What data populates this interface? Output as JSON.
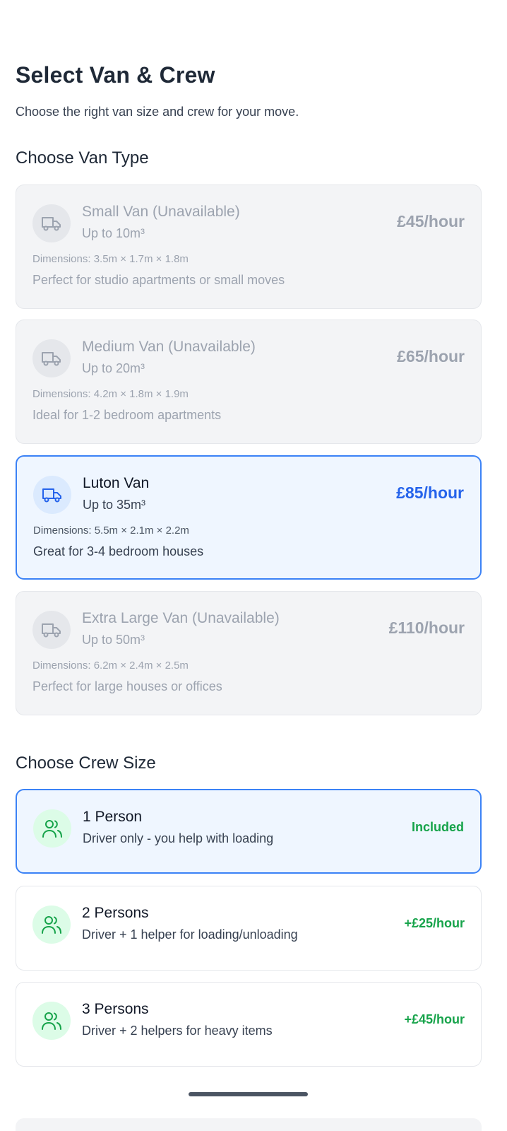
{
  "header": {
    "title": "Select Van & Crew",
    "subtitle": "Choose the right van size and crew for your move."
  },
  "van_section": {
    "title": "Choose Van Type",
    "options": [
      {
        "name": "Small Van (Unavailable)",
        "capacity": "Up to 10m³",
        "dimensions": "Dimensions: 3.5m × 1.7m × 1.8m",
        "description": "Perfect for studio apartments or small moves",
        "price": "£45/hour",
        "state": "unavailable",
        "icon": "truck-icon"
      },
      {
        "name": "Medium Van (Unavailable)",
        "capacity": "Up to 20m³",
        "dimensions": "Dimensions: 4.2m × 1.8m × 1.9m",
        "description": "Ideal for 1-2 bedroom apartments",
        "price": "£65/hour",
        "state": "unavailable",
        "icon": "truck-icon"
      },
      {
        "name": "Luton Van",
        "capacity": "Up to 35m³",
        "dimensions": "Dimensions: 5.5m × 2.1m × 2.2m",
        "description": "Great for 3-4 bedroom houses",
        "price": "£85/hour",
        "state": "selected",
        "icon": "truck-icon"
      },
      {
        "name": "Extra Large Van (Unavailable)",
        "capacity": "Up to 50m³",
        "dimensions": "Dimensions: 6.2m × 2.4m × 2.5m",
        "description": "Perfect for large houses or offices",
        "price": "£110/hour",
        "state": "unavailable",
        "icon": "truck-icon"
      }
    ]
  },
  "crew_section": {
    "title": "Choose Crew Size",
    "options": [
      {
        "name": "1 Person",
        "description": "Driver only - you help with loading",
        "price": "Included",
        "state": "selected",
        "icon": "users-icon"
      },
      {
        "name": "2 Persons",
        "description": "Driver + 1 helper for loading/unloading",
        "price": "+£25/hour",
        "state": "available",
        "icon": "users-icon"
      },
      {
        "name": "3 Persons",
        "description": "Driver + 2 helpers for heavy items",
        "price": "+£45/hour",
        "state": "available",
        "icon": "users-icon"
      }
    ]
  },
  "colors": {
    "accent": "#2563eb",
    "selected_bg": "#eff6ff",
    "selected_border": "#3b82f6",
    "disabled_bg": "#f3f4f6",
    "disabled_text": "#9ca3af",
    "price_green": "#16a34a",
    "crew_icon_bg": "#dcfce7"
  }
}
